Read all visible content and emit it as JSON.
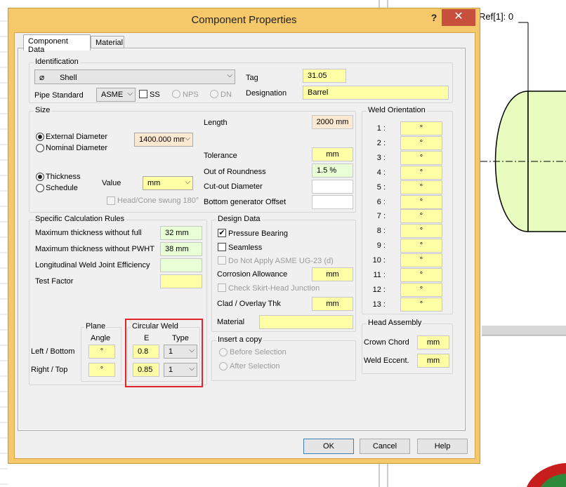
{
  "background": {
    "drawing_label": "Ref[1]: 0"
  },
  "dialog": {
    "title": "Component Properties",
    "help_label": "?",
    "close_label": "✕",
    "tabs": [
      "Component Data",
      "Material"
    ],
    "identification": {
      "group_label": "Identification",
      "component_type": "Shell",
      "tag_label": "Tag",
      "tag_value": "31.05",
      "pipe_standard_label": "Pipe Standard",
      "pipe_standard_value": "ASME",
      "ss_label": "SS",
      "nps_label": "NPS",
      "dn_label": "DN",
      "designation_label": "Designation",
      "designation_value": "Barrel"
    },
    "size": {
      "group_label": "Size",
      "external_diameter_label": "External Diameter",
      "nominal_diameter_label": "Nominal Diameter",
      "diameter_value": "1400.000 mm",
      "thickness_label": "Thickness",
      "schedule_label": "Schedule",
      "value_label": "Value",
      "value_unit": "mm",
      "head_cone_label": "Head/Cone swung 180°",
      "length_label": "Length",
      "length_value": "2000 mm",
      "tolerance_label": "Tolerance",
      "tolerance_value": "mm",
      "out_of_roundness_label": "Out of Roundness",
      "out_of_roundness_value": "1.5 %",
      "cutout_diameter_label": "Cut-out Diameter",
      "bottom_generator_label": "Bottom generator Offset"
    },
    "weld_orientation": {
      "group_label": "Weld Orientation",
      "rows": [
        {
          "label": "1 :",
          "value": "°"
        },
        {
          "label": "2 :",
          "value": "°"
        },
        {
          "label": "3 :",
          "value": "°"
        },
        {
          "label": "4 :",
          "value": "°"
        },
        {
          "label": "5 :",
          "value": "°"
        },
        {
          "label": "6 :",
          "value": "°"
        },
        {
          "label": "7 :",
          "value": "°"
        },
        {
          "label": "8 :",
          "value": "°"
        },
        {
          "label": "9 :",
          "value": "°"
        },
        {
          "label": "10 :",
          "value": "°"
        },
        {
          "label": "11 :",
          "value": "°"
        },
        {
          "label": "12 :",
          "value": "°"
        },
        {
          "label": "13 :",
          "value": "°"
        }
      ]
    },
    "calc_rules": {
      "group_label": "Specific Calculation Rules",
      "max_thk_without_full_label": "Maximum thickness without full",
      "max_thk_without_full_value": "32 mm",
      "max_thk_without_pwht_label": "Maximum thickness without PWHT",
      "max_thk_without_pwht_value": "38 mm",
      "long_weld_label": "Longitudinal Weld Joint Efficiency",
      "test_factor_label": "Test Factor",
      "plane_label": "Plane",
      "angle_label": "Angle",
      "circular_weld_label": "Circular Weld",
      "e_label": "E",
      "type_label": "Type",
      "left_bottom_label": "Left / Bottom",
      "right_top_label": "Right / Top",
      "left_angle": "°",
      "right_angle": "°",
      "left_e": "0.8",
      "right_e": "0.85",
      "left_type": "1",
      "right_type": "1"
    },
    "design_data": {
      "group_label": "Design Data",
      "pressure_bearing_label": "Pressure Bearing",
      "seamless_label": "Seamless",
      "do_not_apply_label": "Do Not Apply ASME UG-23 (d)",
      "corrosion_label": "Corrosion Allowance",
      "corrosion_value": "mm",
      "check_skirt_label": "Check Skirt-Head Junction",
      "clad_label": "Clad / Overlay Thk",
      "clad_value": "mm",
      "material_label": "Material"
    },
    "insert_copy": {
      "group_label": "Insert a copy",
      "before_label": "Before Selection",
      "after_label": "After Selection"
    },
    "head_assembly": {
      "group_label": "Head Assembly",
      "crown_chord_label": "Crown Chord",
      "crown_chord_value": "mm",
      "weld_eccent_label": "Weld Eccent.",
      "weld_eccent_value": "mm"
    },
    "buttons": {
      "ok": "OK",
      "cancel": "Cancel",
      "help": "Help"
    }
  },
  "colors": {
    "dialog_frame": "#f5c96a",
    "close_button": "#c74f3b",
    "yellow_field": "#ffffa6",
    "green_field": "#e8ffd6",
    "highlight_box": "#e0262c",
    "vessel_fill": "#e8fcc0"
  }
}
